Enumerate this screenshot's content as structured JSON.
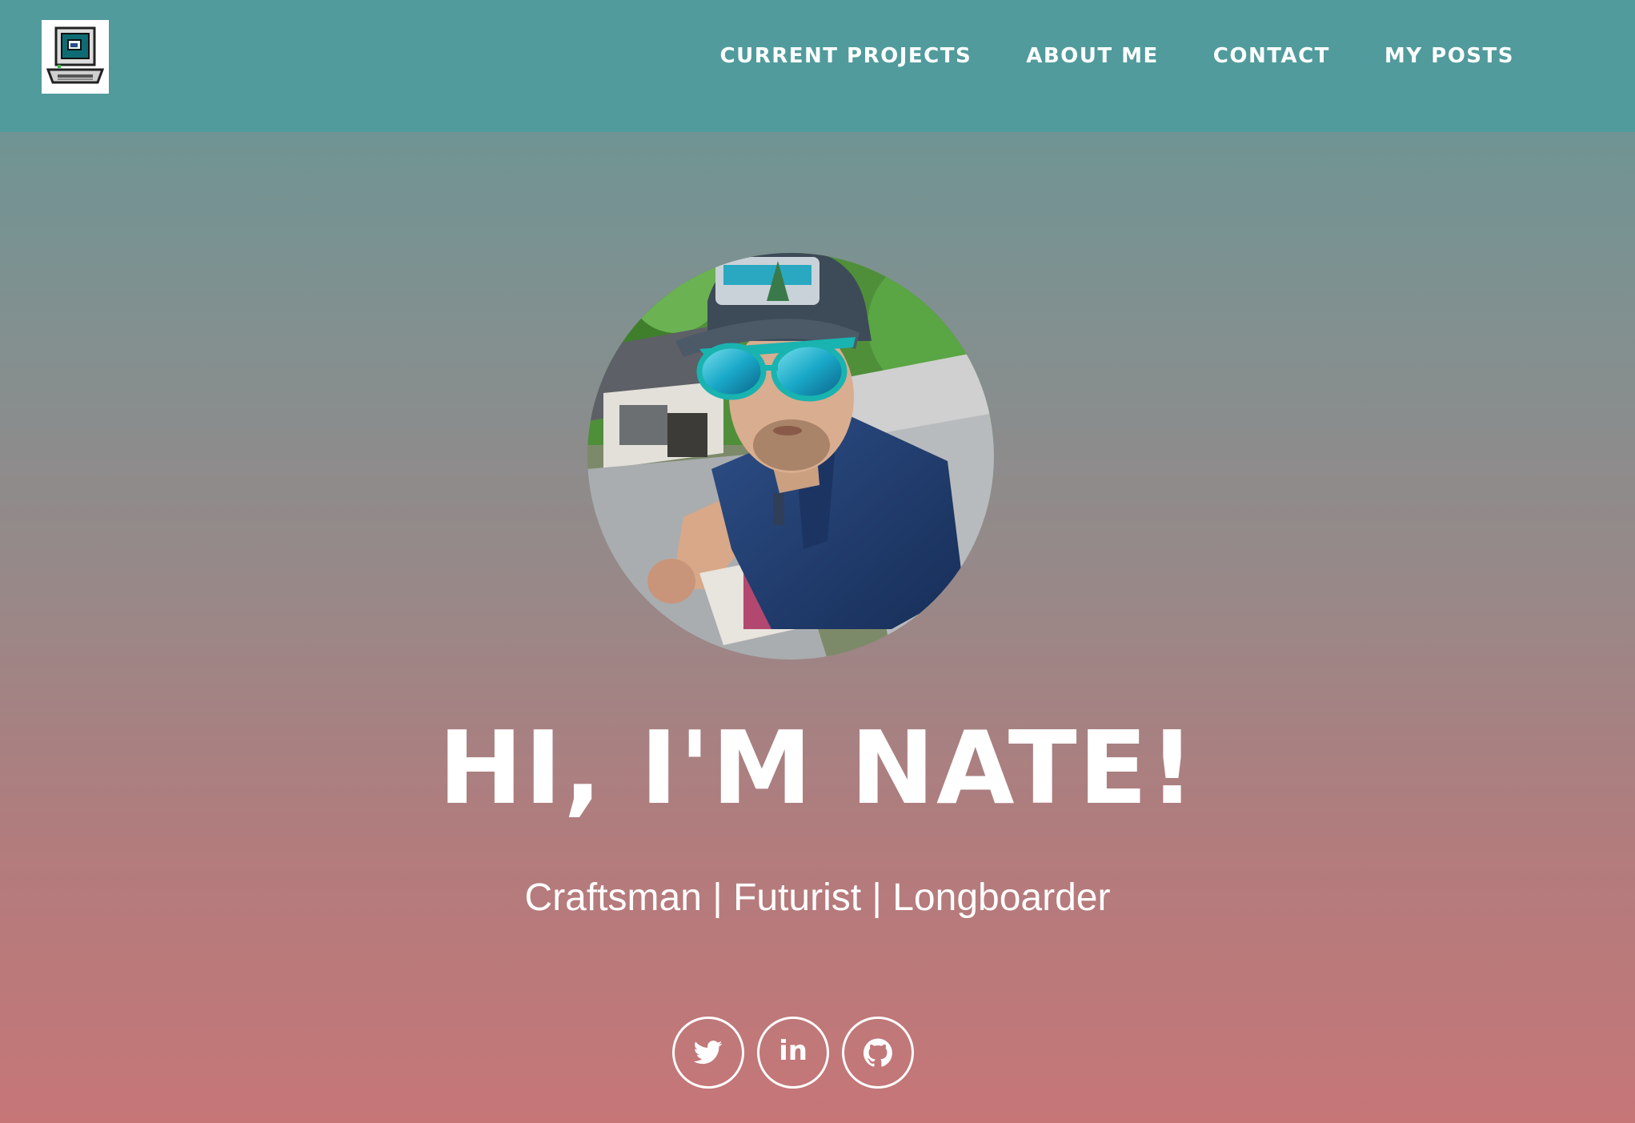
{
  "nav": {
    "logo_icon": "retro-computer-icon",
    "items": [
      {
        "label": "CURRENT PROJECTS"
      },
      {
        "label": "ABOUT ME"
      },
      {
        "label": "CONTACT"
      },
      {
        "label": "MY POSTS"
      }
    ]
  },
  "hero": {
    "avatar_icon": "profile-photo",
    "heading": "HI, I'M NATE!",
    "subheading": "Craftsman | Futurist | Longboarder"
  },
  "social": {
    "items": [
      {
        "icon": "twitter-icon"
      },
      {
        "icon": "linkedin-icon",
        "glyph": "in"
      },
      {
        "icon": "github-icon"
      }
    ]
  },
  "colors": {
    "navbar": "#519b9c",
    "gradient_top": "#629795",
    "gradient_bottom": "#c67677",
    "text": "#ffffff"
  }
}
